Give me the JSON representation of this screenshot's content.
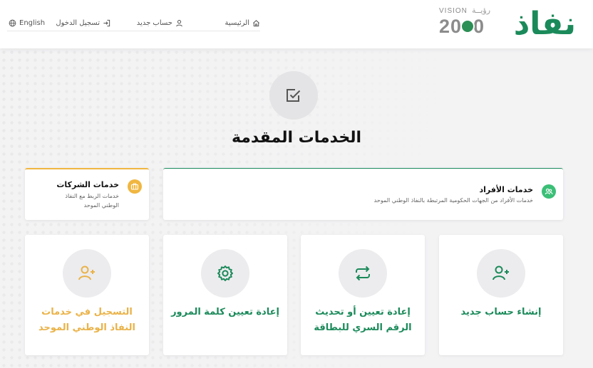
{
  "header": {
    "logo_text": "نفاذ",
    "vision": {
      "label": "VISION",
      "script": "رؤيــة",
      "year": "2030"
    },
    "nav": {
      "home": "الرئيسية",
      "new_account": "حساب جديد",
      "login": "تسجيل الدخول",
      "language": "English"
    }
  },
  "main": {
    "title": "الخدمات المقدمة",
    "tabs": {
      "individuals": {
        "title": "خدمات الأفراد",
        "description": "خدمات الأفراد من الجهات الحكومية المرتبطة بالنفاذ الوطني الموحد"
      },
      "companies": {
        "title": "خدمات الشركات",
        "description": "خدمات الربط مع النفاذ الوطني الموحد"
      }
    },
    "services": [
      {
        "label": "إنشاء حساب جديد",
        "icon": "add-user-icon"
      },
      {
        "label": "إعادة تعيين أو تحديث الرقم السري للبطاقة",
        "icon": "repeat-icon"
      },
      {
        "label": "إعادة تعيين كلمة المرور",
        "icon": "gear-icon"
      },
      {
        "label": "التسجيل في خدمات النفاذ الوطني الموحد",
        "icon": "add-user-icon"
      }
    ]
  },
  "colors": {
    "brand": "#1b8a5a",
    "accent_gold": "#eab247",
    "badge_green": "#3bbf77"
  }
}
